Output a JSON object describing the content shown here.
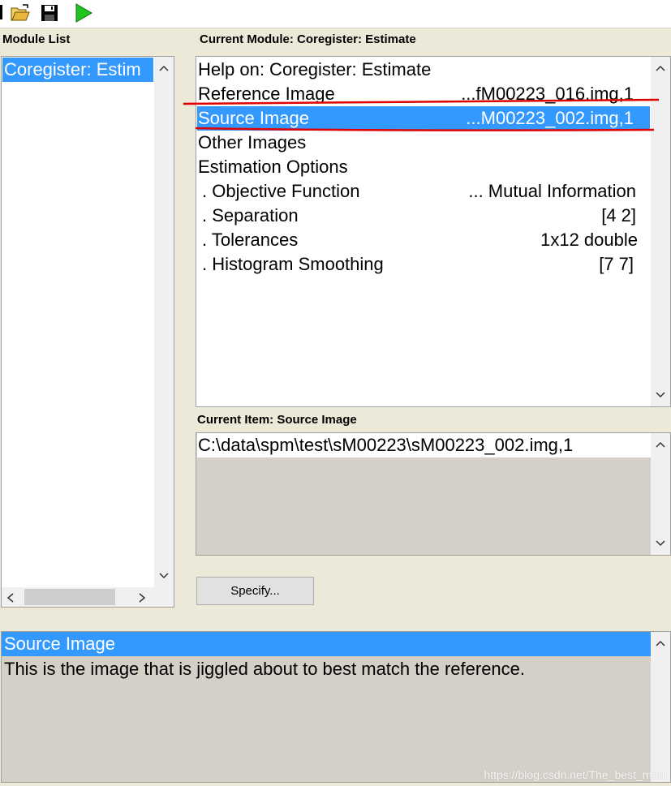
{
  "toolbar": {
    "open_icon": "open-folder-icon",
    "save_icon": "save-icon",
    "run_icon": "run-icon"
  },
  "module_list": {
    "title": "Module List",
    "items": [
      "Coregister: Estim"
    ]
  },
  "current_module": {
    "title": "Current Module: Coregister: Estimate",
    "rows": [
      {
        "label": "Help on: Coregister: Estimate",
        "value": ""
      },
      {
        "label": "Reference Image",
        "value": "...fM00223_016.img,1"
      },
      {
        "label": "Source Image",
        "value": "...M00223_002.img,1"
      },
      {
        "label": "Other Images",
        "value": ""
      },
      {
        "label": "Estimation Options",
        "value": ""
      },
      {
        "label": " . Objective Function",
        "value": "... Mutual Information"
      },
      {
        "label": " . Separation",
        "value": "[4 2]"
      },
      {
        "label": " . Tolerances",
        "value": "1x12 double"
      },
      {
        "label": " . Histogram Smoothing",
        "value": "[7 7]"
      }
    ]
  },
  "current_item": {
    "title": "Current Item: Source Image",
    "value": "C:\\data\\spm\\test\\sM00223\\sM00223_002.img,1"
  },
  "specify_button": "Specify...",
  "help": {
    "title": "Source Image",
    "text": "This is the image that is jiggled about to best match the reference."
  },
  "watermark": "https://blog.csdn.net/The_best_man",
  "colors": {
    "selection": "#3399ff",
    "annotation": "#e00000",
    "background": "#ece9d8"
  }
}
